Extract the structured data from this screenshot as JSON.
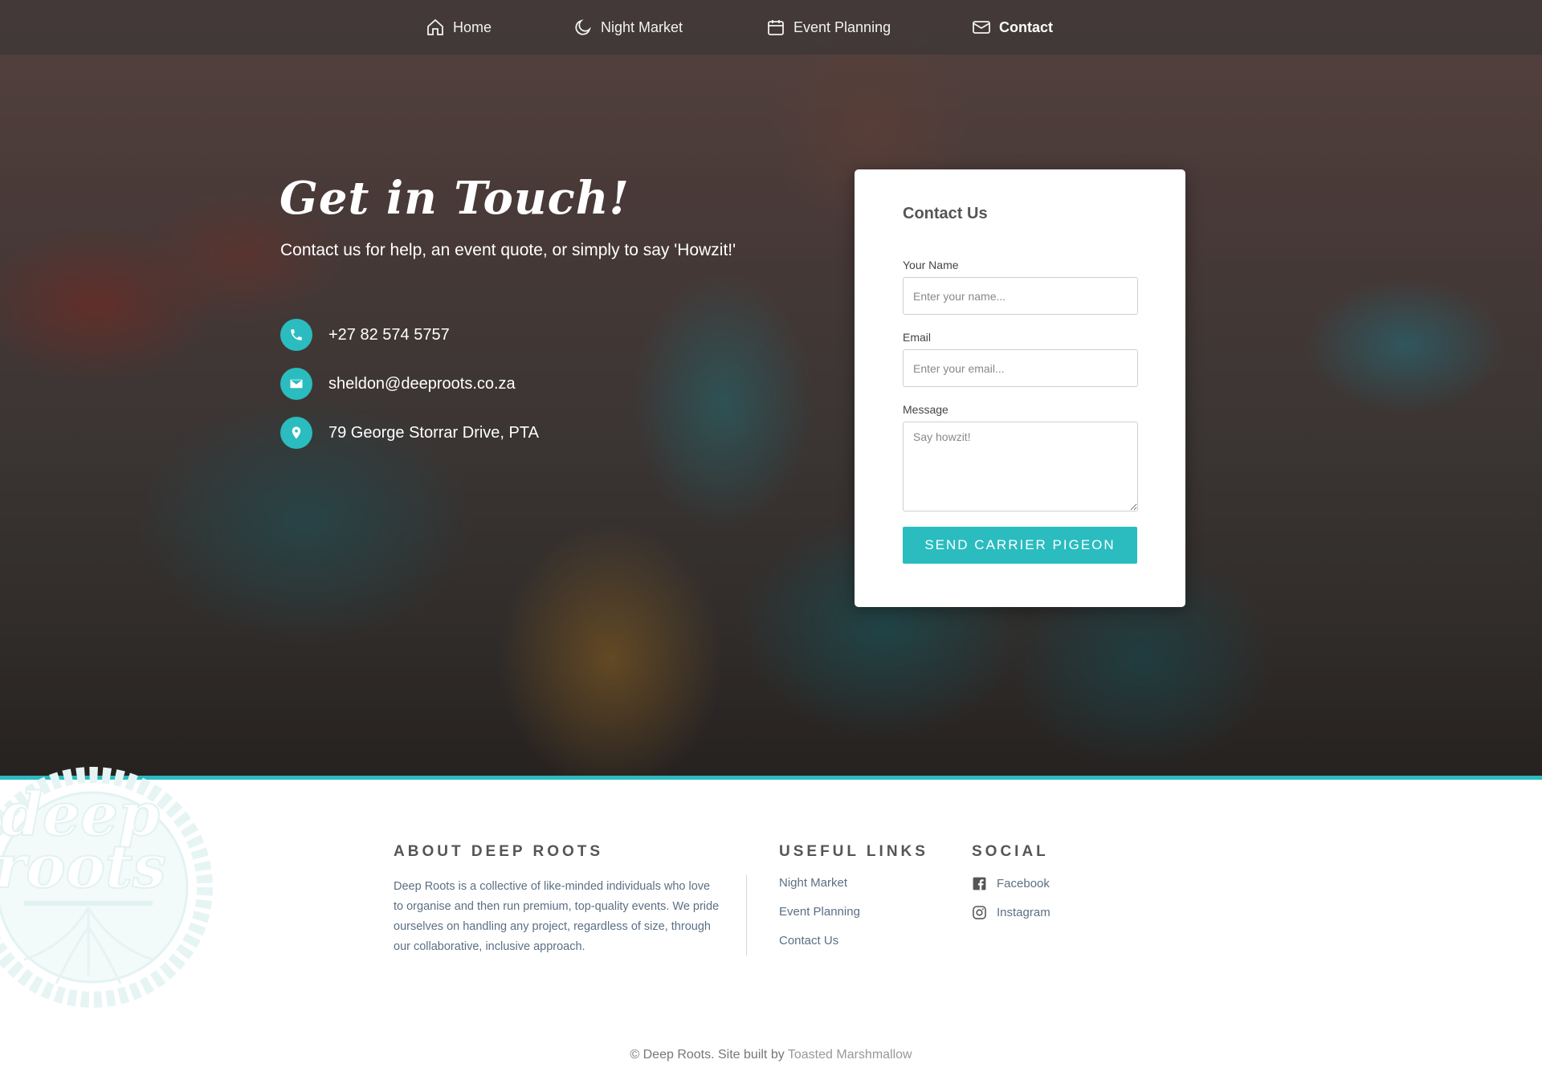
{
  "nav": {
    "items": [
      {
        "label": "Home",
        "icon": "home-icon"
      },
      {
        "label": "Night Market",
        "icon": "moon-icon"
      },
      {
        "label": "Event Planning",
        "icon": "calendar-icon"
      },
      {
        "label": "Contact",
        "icon": "mail-icon",
        "active": true
      }
    ]
  },
  "hero": {
    "title": "Get in Touch!",
    "subtitle": "Contact us for help, an event quote, or simply to say 'Howzit!'",
    "contacts": [
      {
        "icon": "phone-icon",
        "text": "+27 82 574 5757"
      },
      {
        "icon": "envelope-icon",
        "text": "sheldon@deeproots.co.za"
      },
      {
        "icon": "location-pin-icon",
        "text": "79 George Storrar Drive, PTA"
      }
    ]
  },
  "form": {
    "title": "Contact Us",
    "name_label": "Your Name",
    "name_placeholder": "Enter your name...",
    "email_label": "Email",
    "email_placeholder": "Enter your email...",
    "message_label": "Message",
    "message_placeholder": "Say howzit!",
    "submit_label": "SEND CARRIER PIGEON"
  },
  "footer": {
    "logo_text": [
      "deep",
      "roots"
    ],
    "about_heading": "ABOUT DEEP ROOTS",
    "about_text": "Deep Roots is a collective of like-minded individuals who love to organise and then run premium, top-quality events. We pride ourselves on handling any project, regardless of size, through our collaborative, inclusive approach.",
    "links_heading": "USEFUL LINKS",
    "links": [
      "Night Market",
      "Event Planning",
      "Contact Us"
    ],
    "social_heading": "SOCIAL",
    "social": [
      {
        "label": "Facebook",
        "icon": "facebook-icon"
      },
      {
        "label": "Instagram",
        "icon": "instagram-icon"
      }
    ],
    "copyright": "© Deep Roots. Site built by",
    "credit": "Toasted Marshmallow"
  },
  "colors": {
    "accent": "#2abcbf",
    "footer_text": "#5c6f84"
  }
}
